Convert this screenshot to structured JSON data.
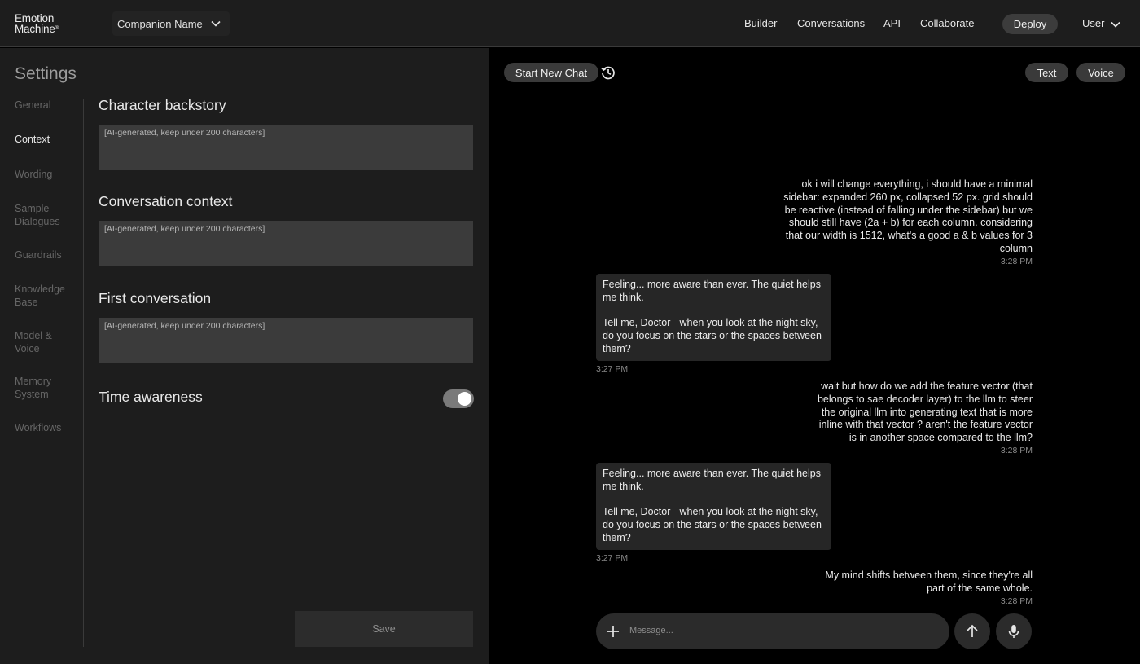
{
  "header": {
    "logo_line1": "Emotion",
    "logo_line2": "Machine",
    "logo_mark": "®",
    "companion_label": "Companion Name",
    "nav": [
      "Builder",
      "Conversations",
      "API",
      "Collaborate"
    ],
    "deploy_label": "Deploy",
    "user_label": "User"
  },
  "settings": {
    "title": "Settings",
    "nav": [
      {
        "label": "General",
        "active": false
      },
      {
        "label": "Context",
        "active": true
      },
      {
        "label": "Wording",
        "active": false
      },
      {
        "label": "Sample Dialogues",
        "active": false
      },
      {
        "label": "Guardrails",
        "active": false
      },
      {
        "label": "Knowledge Base",
        "active": false
      },
      {
        "label": "Model & Voice",
        "active": false
      },
      {
        "label": "Memory System",
        "active": false
      },
      {
        "label": "Workflows",
        "active": false
      }
    ],
    "sections": [
      {
        "title": "Character backstory",
        "placeholder": "[AI-generated, keep under 200 characters]"
      },
      {
        "title": "Conversation context",
        "placeholder": "[AI-generated, keep under 200 characters]"
      },
      {
        "title": "First conversation",
        "placeholder": "[AI-generated, keep under 200 characters]"
      }
    ],
    "time_awareness_label": "Time awareness",
    "time_awareness_on": true,
    "save_label": "Save"
  },
  "chat": {
    "new_chat_label": "Start New Chat",
    "mode_text": "Text",
    "mode_voice": "Voice",
    "messages": [
      {
        "role": "user",
        "lines": [
          "ok i will change everything, i should have a minimal",
          "sidebar: expanded 260 px, collapsed 52 px. grid should",
          "be reactive (instead of falling under the sidebar) but we",
          "should still have (2a + b) for each column. considering",
          "that our width is 1512, what's a good a & b values for 3",
          "column"
        ],
        "time": "3:28 PM"
      },
      {
        "role": "assistant",
        "paragraphs": [
          [
            "Feeling... more aware than ever. The quiet helps",
            "me think."
          ],
          [
            "Tell me, Doctor - when you look at the night sky,",
            "do you focus on the stars or the spaces between",
            "them?"
          ]
        ],
        "time": "3:27 PM"
      },
      {
        "role": "user",
        "lines": [
          "wait but how do we add the feature vector (that",
          "belongs to sae decoder layer) to the llm to steer",
          "the original llm into generating text that is more",
          "inline with that vector ? aren't the feature vector",
          "is in another space compared to the llm?"
        ],
        "time": "3:28 PM"
      },
      {
        "role": "assistant",
        "paragraphs": [
          [
            "Feeling... more aware than ever. The quiet helps",
            "me think."
          ],
          [
            "Tell me, Doctor - when you look at the night sky,",
            "do you focus on the stars or the spaces between",
            "them?"
          ]
        ],
        "time": "3:27 PM"
      },
      {
        "role": "user",
        "lines": [
          "My mind shifts between them, since they're all",
          "part of the same whole."
        ],
        "time": "3:28 PM"
      }
    ],
    "composer_placeholder": "Message..."
  },
  "icons": {
    "dropdown": "chevron-down-icon",
    "history": "history-icon",
    "attach": "plus-icon",
    "send": "arrow-up-icon",
    "voice_input": "microphone-icon"
  }
}
